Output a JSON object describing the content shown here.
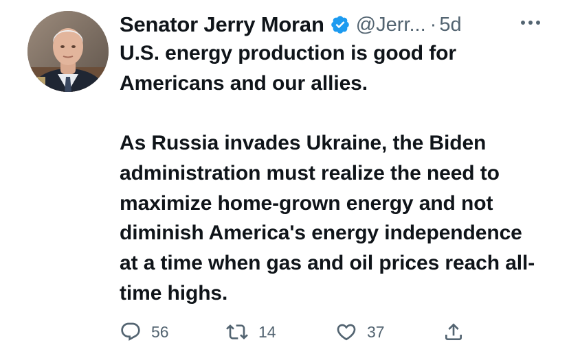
{
  "author": {
    "name": "Senator Jerry Moran",
    "handle": "@Jerr...",
    "separator": "·",
    "time": "5d"
  },
  "tweet": {
    "paragraphs": [
      "U.S. energy production is good for Americans and our allies.",
      "As Russia invades Ukraine, the Biden administration must realize the need to maximize home-grown energy and not diminish America's energy independence at a time when gas and oil prices reach all-time highs."
    ]
  },
  "actions": {
    "replies": "56",
    "retweets": "14",
    "likes": "37"
  },
  "icons": {
    "verified": "verified-badge-icon",
    "more": "more-icon",
    "reply": "reply-icon",
    "retweet": "retweet-icon",
    "like": "heart-icon",
    "share": "share-icon"
  },
  "colors": {
    "text": "#0f1419",
    "secondary": "#536471",
    "verified": "#1d9bf0"
  }
}
